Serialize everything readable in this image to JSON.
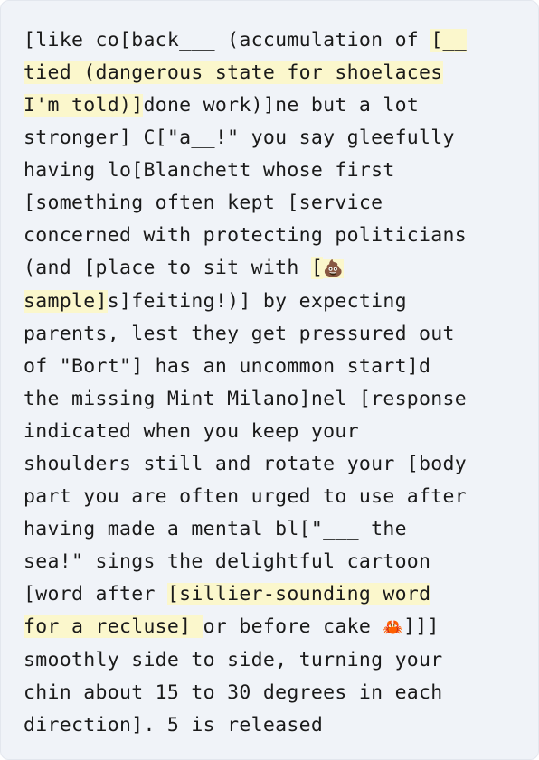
{
  "document": {
    "lines": [
      [
        "[like co[back___ (accumulation of ",
        "HL:[__"
      ],
      [
        "HL:tied (dangerous state for shoelaces"
      ],
      [
        "HL:I'm told)]",
        "done work)]ne but a lot"
      ],
      [
        "stronger] C[\"a__!\" you say gleefully"
      ],
      [
        "having lo[Blanchett whose first"
      ],
      [
        "[something often kept [service"
      ],
      [
        "concerned with protecting politicians"
      ],
      [
        "(and [place to sit with ",
        "HL:[",
        "HLEMO:poop"
      ],
      [
        "HL:sample]",
        "s]feiting!)] by expecting"
      ],
      [
        "parents, lest they get pressured out"
      ],
      [
        "of \"Bort\"] has an uncommon start]d"
      ],
      [
        "the missing Mint Milano]nel [response"
      ],
      [
        "indicated when you keep your"
      ],
      [
        "shoulders still and rotate your [body"
      ],
      [
        "part you are often urged to use after"
      ],
      [
        "having made a mental bl[\"___ the"
      ],
      [
        "sea!\" sings the delightful cartoon"
      ],
      [
        "[word after ",
        "HL:[sillier-sounding word"
      ],
      [
        "HL:for a recluse] ",
        "or before cake ",
        "EMO:crab",
        "]]]"
      ],
      [
        "smoothly side to side, turning your"
      ],
      [
        "chin about 15 to 30 degrees in each"
      ],
      [
        "direction]. 5 is released"
      ]
    ],
    "emoji": {
      "poop": "💩",
      "crab": "🦀"
    }
  }
}
